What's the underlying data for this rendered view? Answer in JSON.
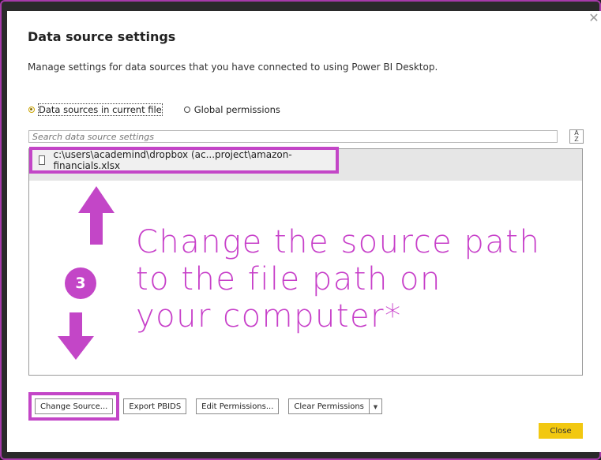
{
  "dialog": {
    "title": "Data source settings",
    "subtitle": "Manage settings for data sources that you have connected to using Power BI Desktop."
  },
  "scope": {
    "current_file_label": "Data sources in current file",
    "global_label": "Global permissions",
    "selected": "current_file"
  },
  "search": {
    "placeholder": "Search data source settings"
  },
  "sort": {
    "top": "A",
    "bottom": "Z"
  },
  "sources": [
    {
      "path": "c:\\users\\academind\\dropbox (ac...project\\amazon-financials.xlsx"
    }
  ],
  "annotation": {
    "step": "3",
    "lines": [
      "Change the source path",
      "to the file path on",
      "your computer*"
    ]
  },
  "buttons": {
    "change_source": "Change Source...",
    "export_pbids": "Export PBIDS",
    "edit_permissions": "Edit Permissions...",
    "clear_permissions": "Clear Permissions",
    "close": "Close"
  },
  "icons": {
    "close": "close-icon",
    "sort": "sort-az-icon",
    "file": "file-icon",
    "dropdown": "chevron-down-icon"
  },
  "colors": {
    "annotation": "#c346c7",
    "close_button": "#f2c811",
    "frame": "#a63aa9"
  }
}
